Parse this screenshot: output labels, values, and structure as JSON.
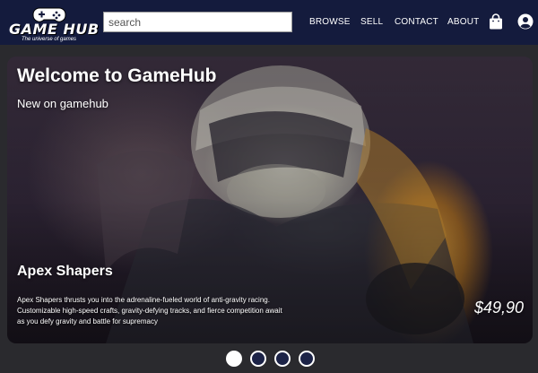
{
  "header": {
    "logo": {
      "title": "GAME HUB",
      "tagline": "The universe of games"
    },
    "search": {
      "placeholder": "search",
      "value": ""
    },
    "nav": [
      {
        "label": "BROWSE"
      },
      {
        "label": "SELL"
      },
      {
        "label": "CONTACT"
      },
      {
        "label": "ABOUT"
      }
    ],
    "icons": [
      "shopping-bag-icon",
      "user-account-icon"
    ],
    "background_color": "#141b3d"
  },
  "hero": {
    "title": "Welcome to GameHub",
    "subtitle": "New on gamehub",
    "game": {
      "title": "Apex Shapers",
      "description": "Apex Shapers thrusts you into the adrenaline-fueled world of anti-gravity racing. Customizable high-speed crafts, gravity-defying tracks, and fierce competition await as you defy gravity and battle for supremacy",
      "price": "$49,90"
    }
  },
  "carousel": {
    "slides": 4,
    "active_index": 0
  }
}
